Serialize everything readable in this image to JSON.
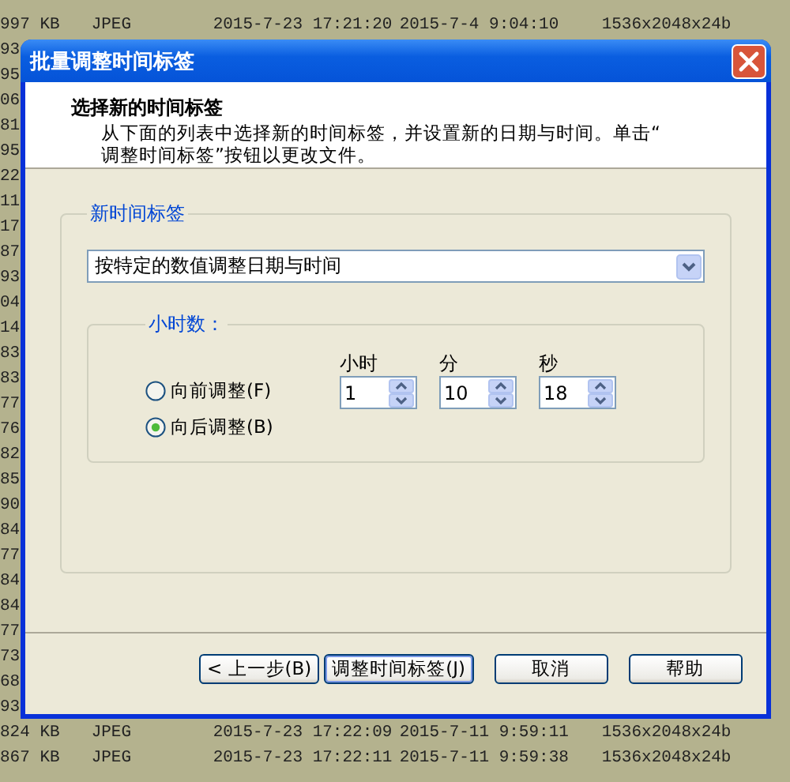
{
  "background_list": {
    "rows": [
      {
        "size": "997 KB",
        "type": "JPEG",
        "created": "2015-7-23 17:21:20",
        "taken": "2015-7-4 9:04:10",
        "dimensions": "1536x2048x24b"
      },
      {
        "size": "93"
      },
      {
        "size": "95"
      },
      {
        "size": "06"
      },
      {
        "size": "81"
      },
      {
        "size": "95"
      },
      {
        "size": "22"
      },
      {
        "size": "11"
      },
      {
        "size": "17"
      },
      {
        "size": "87"
      },
      {
        "size": "93"
      },
      {
        "size": "04"
      },
      {
        "size": "14"
      },
      {
        "size": "83"
      },
      {
        "size": "83"
      },
      {
        "size": "77"
      },
      {
        "size": "76"
      },
      {
        "size": "82"
      },
      {
        "size": "85"
      },
      {
        "size": "90"
      },
      {
        "size": "84"
      },
      {
        "size": "77"
      },
      {
        "size": "84"
      },
      {
        "size": "84"
      },
      {
        "size": "77"
      },
      {
        "size": "73"
      },
      {
        "size": "68"
      },
      {
        "size": "93"
      },
      {
        "size": "824 KB",
        "type": "JPEG",
        "created": "2015-7-23 17:22:09",
        "taken": "2015-7-11 9:59:11",
        "dimensions": "1536x2048x24b"
      },
      {
        "size": "867 KB",
        "type": "JPEG",
        "created": "2015-7-23 17:22:11",
        "taken": "2015-7-11 9:59:38",
        "dimensions": "1536x2048x24b"
      }
    ]
  },
  "dialog": {
    "title": "批量调整时间标签",
    "header": {
      "title": "选择新的时间标签",
      "description_lines": [
        "从下面的列表中选择新的时间标签，并设置新的日期与时间。单击“",
        "调整时间标签”按钮以更改文件。"
      ]
    },
    "group": {
      "label": "新时间标签",
      "dropdown": {
        "value": "按特定的数值调整日期与时间"
      },
      "subgroup": {
        "label": "小时数：",
        "radios": [
          {
            "label": "向前调整(F)",
            "selected": false
          },
          {
            "label": "向后调整(B)",
            "selected": true
          }
        ],
        "spinners": [
          {
            "label": "小时",
            "value": "1"
          },
          {
            "label": "分",
            "value": "10"
          },
          {
            "label": "秒",
            "value": "18"
          }
        ]
      }
    },
    "buttons": [
      {
        "label": "< 上一步(B)",
        "default": false
      },
      {
        "label": "调整时间标签(J)",
        "default": true
      },
      {
        "label": "取消",
        "default": false
      },
      {
        "label": "帮助",
        "default": false
      }
    ]
  }
}
